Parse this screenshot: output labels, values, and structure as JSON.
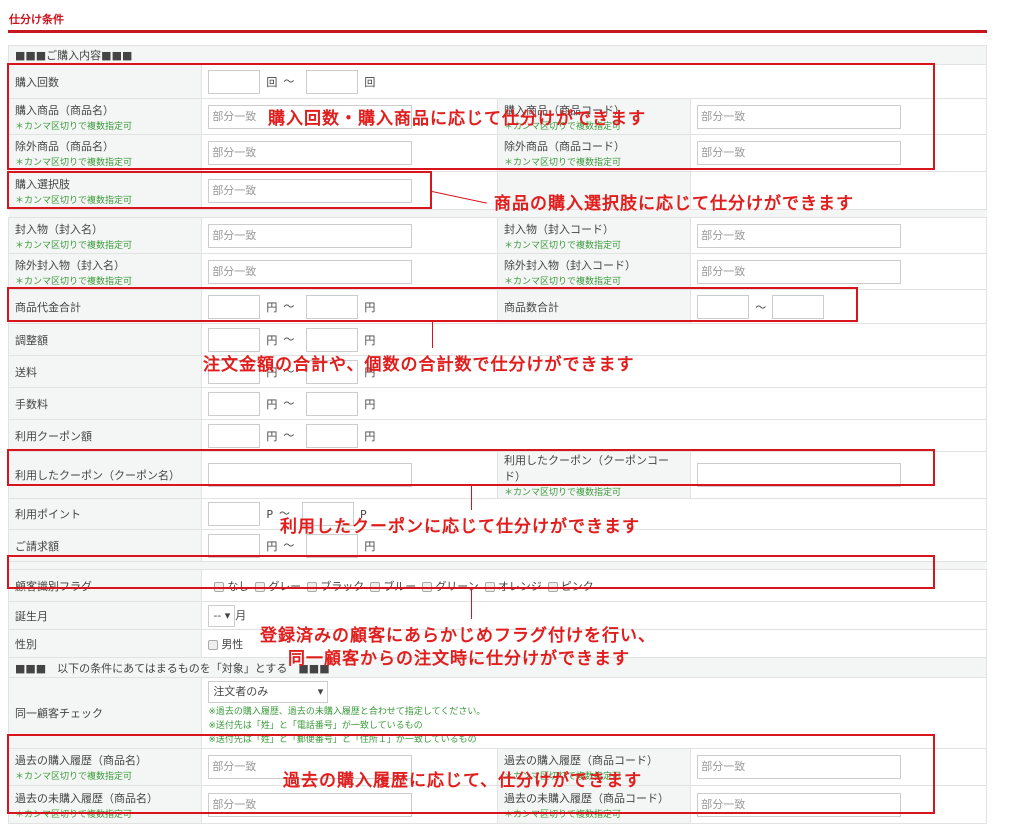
{
  "title": "仕分け条件",
  "sections": {
    "purchase": "■■■ご購入内容■■■",
    "target": "■■■　以下の条件にあてはまるものを「対象」とする　■■■"
  },
  "note": "＊カンマ区切りで複数指定可",
  "placeholder": "部分一致",
  "tilde": "～",
  "rows": {
    "purchase_count": {
      "label": "購入回数",
      "unit": "回"
    },
    "product_name": {
      "label": "購入商品（商品名）"
    },
    "product_code": {
      "label": "購入商品（商品コード）"
    },
    "excl_name": {
      "label": "除外商品（商品名）"
    },
    "excl_code": {
      "label": "除外商品（商品コード）"
    },
    "option": {
      "label": "購入選択肢"
    },
    "insert_name": {
      "label": "封入物（封入名）"
    },
    "insert_code": {
      "label": "封入物（封入コード）"
    },
    "excl_insert_name": {
      "label": "除外封入物（封入名）"
    },
    "excl_insert_code": {
      "label": "除外封入物（封入コード）"
    },
    "subtotal": {
      "label": "商品代金合計",
      "unit": "円"
    },
    "item_count": {
      "label": "商品数合計"
    },
    "adjust": {
      "label": "調整額",
      "unit": "円"
    },
    "shipping": {
      "label": "送料",
      "unit": "円"
    },
    "fee": {
      "label": "手数料",
      "unit": "円"
    },
    "coupon_amount": {
      "label": "利用クーポン額",
      "unit": "円"
    },
    "coupon_name": {
      "label": "利用したクーポン（クーポン名）"
    },
    "coupon_code": {
      "label": "利用したクーポン（クーポンコード）"
    },
    "points": {
      "label": "利用ポイント",
      "unit": "P"
    },
    "billing": {
      "label": "ご請求額",
      "unit": "円"
    },
    "flag": {
      "label": "顧客識別フラグ",
      "options": [
        "なし",
        "グレー",
        "ブラック",
        "ブルー",
        "グリーン",
        "オレンジ",
        "ピンク"
      ]
    },
    "birth_month": {
      "label": "誕生月",
      "value": "--",
      "unit": "月"
    },
    "gender": {
      "label": "性別",
      "options": [
        "男性"
      ]
    },
    "same_customer": {
      "label": "同一顧客チェック",
      "value": "注文者のみ",
      "notes": [
        "※過去の購入履歴、過去の未購入履歴と合わせて指定してください。",
        "※送付先は「姓」と「電話番号」が一致しているもの",
        "※送付先は「姓」と「郵便番号」と「住所１」が一致しているもの"
      ]
    },
    "history_name": {
      "label": "過去の購入履歴（商品名）"
    },
    "history_code": {
      "label": "過去の購入履歴（商品コード）"
    },
    "unpurchased_name": {
      "label": "過去の未購入履歴（商品名）"
    },
    "unpurchased_code": {
      "label": "過去の未購入履歴（商品コード）"
    }
  },
  "annotations": [
    "購入回数・購入商品に応じて仕分けができます",
    "商品の購入選択肢に応じて仕分けができます",
    "注文金額の合計や、個数の合計数で仕分けができます",
    "利用したクーポンに応じて仕分けができます",
    "登録済みの顧客にあらかじめフラグ付けを行い、",
    "同一顧客からの注文時に仕分けができます",
    "過去の購入履歴に応じて、仕分けができます"
  ],
  "colors": {
    "accent": "#c8161d",
    "note": "#3a9a3a"
  }
}
